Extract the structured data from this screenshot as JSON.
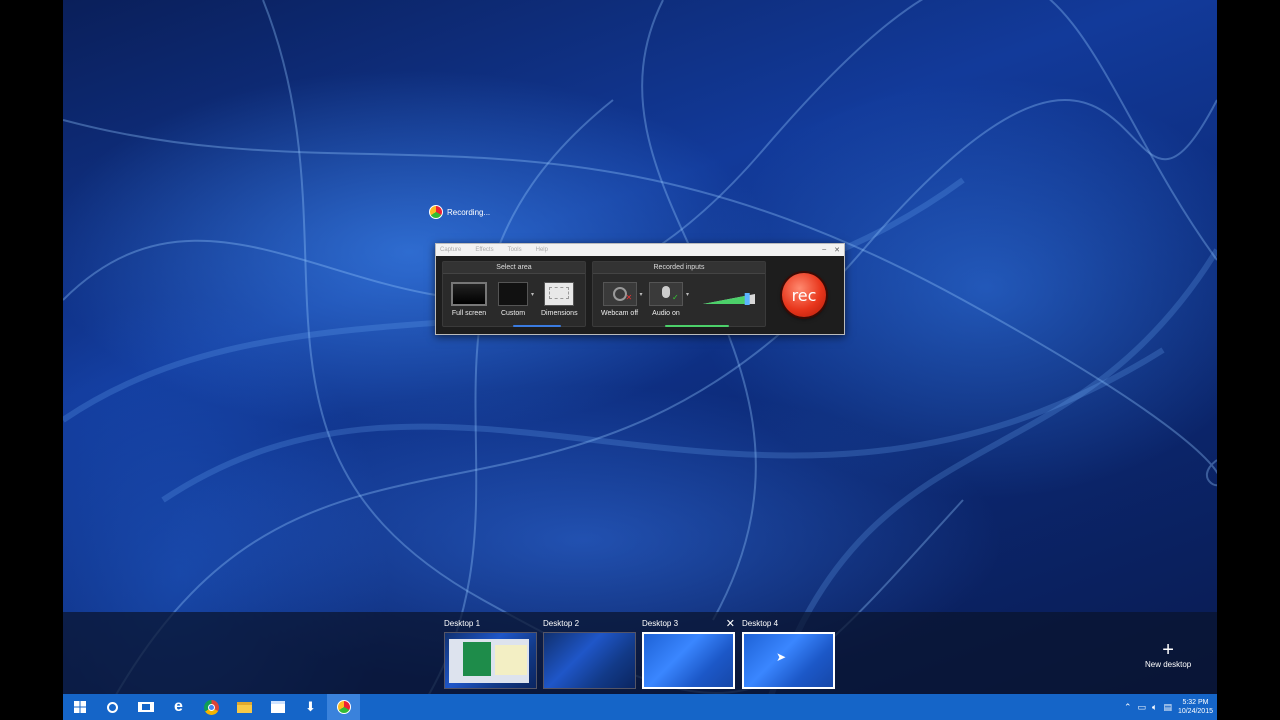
{
  "recording_indicator": {
    "text": "Recording..."
  },
  "recorder": {
    "menu": [
      "Capture",
      "Effects",
      "Tools",
      "Help"
    ],
    "select_area": {
      "title": "Select area",
      "full_screen": "Full screen",
      "custom": "Custom",
      "dimensions": "Dimensions"
    },
    "recorded_inputs": {
      "title": "Recorded inputs",
      "webcam": "Webcam off",
      "audio": "Audio on",
      "audio_level": 0.85
    },
    "rec_button": "rec"
  },
  "task_view": {
    "desktops": [
      {
        "label": "Desktop 1"
      },
      {
        "label": "Desktop 2"
      },
      {
        "label": "Desktop 3",
        "close": "✕"
      },
      {
        "label": "Desktop 4"
      }
    ],
    "new_desktop": "New desktop"
  },
  "taskbar": {
    "clock_time": "5:32 PM",
    "clock_date": "10/24/2015"
  },
  "colors": {
    "taskbar": "#1565c8",
    "rec_red": "#e8361c",
    "accent_blue": "#3a86ff"
  }
}
